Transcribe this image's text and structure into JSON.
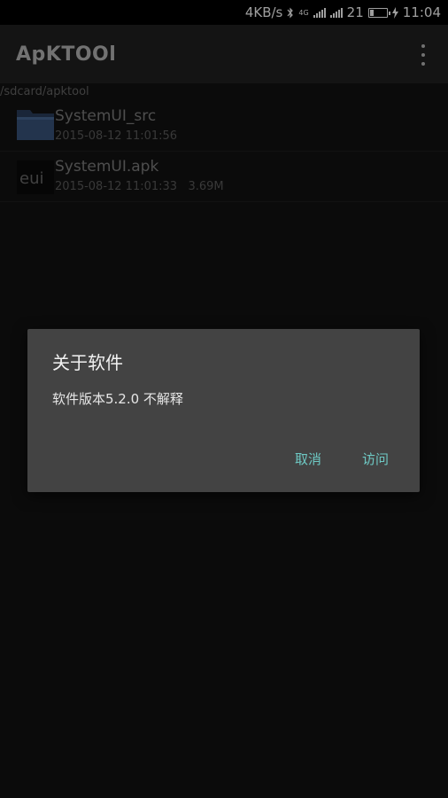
{
  "status_bar": {
    "speed": "4KB/s",
    "bluetooth_icon": "bluetooth-icon",
    "network": "4G",
    "battery_percent": "21",
    "time": "11:04",
    "charging_icon": "lightning-icon"
  },
  "app_bar": {
    "title": "ApKTOOl",
    "overflow_icon": "more-vert-icon"
  },
  "path": "/sdcard/apktool",
  "files": [
    {
      "icon": "folder-icon",
      "name": "SystemUI_src",
      "meta": "2015-08-12 11:01:56"
    },
    {
      "icon": "eui-apk-icon",
      "icon_text": "eui",
      "name": "SystemUI.apk",
      "meta": "2015-08-12 11:01:33   3.69M"
    }
  ],
  "dialog": {
    "title": "关于软件",
    "message": "软件版本5.2.0 不解释",
    "cancel_label": "取消",
    "visit_label": "访问"
  },
  "colors": {
    "background": "#121212",
    "app_bar": "#212121",
    "dialog": "#434343",
    "accent": "#6ec9c4"
  }
}
